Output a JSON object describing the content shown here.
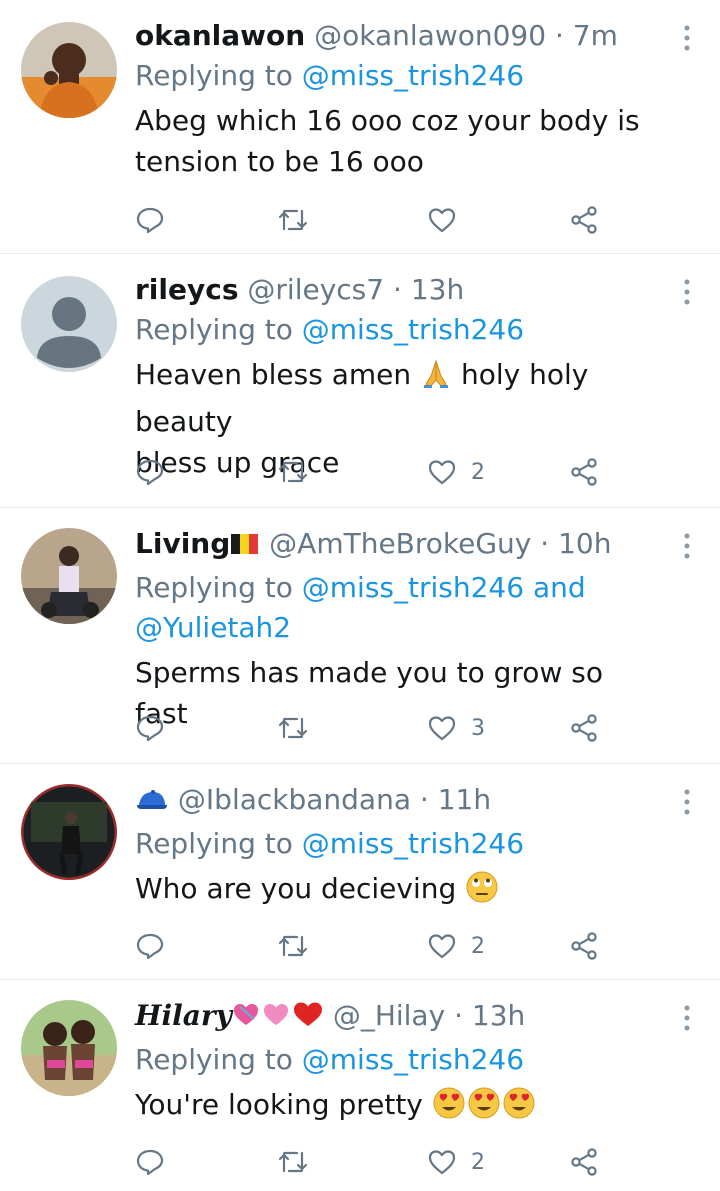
{
  "replying_prefix": "Replying to",
  "tweets": [
    {
      "name": "okanlawon",
      "handle": "@okanlawon090",
      "time": "7m",
      "replying_to": "@miss_trish246",
      "replying_to_2": "",
      "replying_and": "",
      "text_lines": [
        "Abeg which 16 ooo coz your body is",
        "tension to be 16 ooo"
      ],
      "likes": ""
    },
    {
      "name": "rileycs",
      "handle": "@rileycs7",
      "time": "13h",
      "replying_to": "@miss_trish246",
      "replying_to_2": "",
      "replying_and": "",
      "text_pre": "Heaven bless amen ",
      "text_emoji": "folded-hands-emoji",
      "text_post": " holy holy beauty",
      "text_line2": "bless up grace",
      "likes": "2"
    },
    {
      "name": "Living",
      "name_emoji": "belgium-flag-emoji",
      "handle": "@AmTheBrokeGuy",
      "time": "10h",
      "replying_to": "@miss_trish246",
      "replying_and": "and",
      "replying_to_2": "@Yulietah2",
      "text_lines": [
        "Sperms has made you to grow so fast"
      ],
      "likes": "3"
    },
    {
      "name": "",
      "name_emoji": "blue-cap-emoji",
      "handle": "@Iblackbandana",
      "time": "11h",
      "replying_to": "@miss_trish246",
      "text_pre": "Who are you decieving ",
      "text_emoji": "eye-roll-emoji",
      "likes": "2"
    },
    {
      "name": "Hilary",
      "name_emoji": "hearts-emoji",
      "handle": "@_Hilay",
      "time": "13h",
      "replying_to": "@miss_trish246",
      "text_pre": "You're looking pretty ",
      "text_emoji": "heart-eyes-emoji",
      "likes": "2"
    }
  ],
  "colors": {
    "name": "#14171a",
    "meta": "#657786",
    "mention": "#1b95e0",
    "divider": "#e6ecf0"
  }
}
